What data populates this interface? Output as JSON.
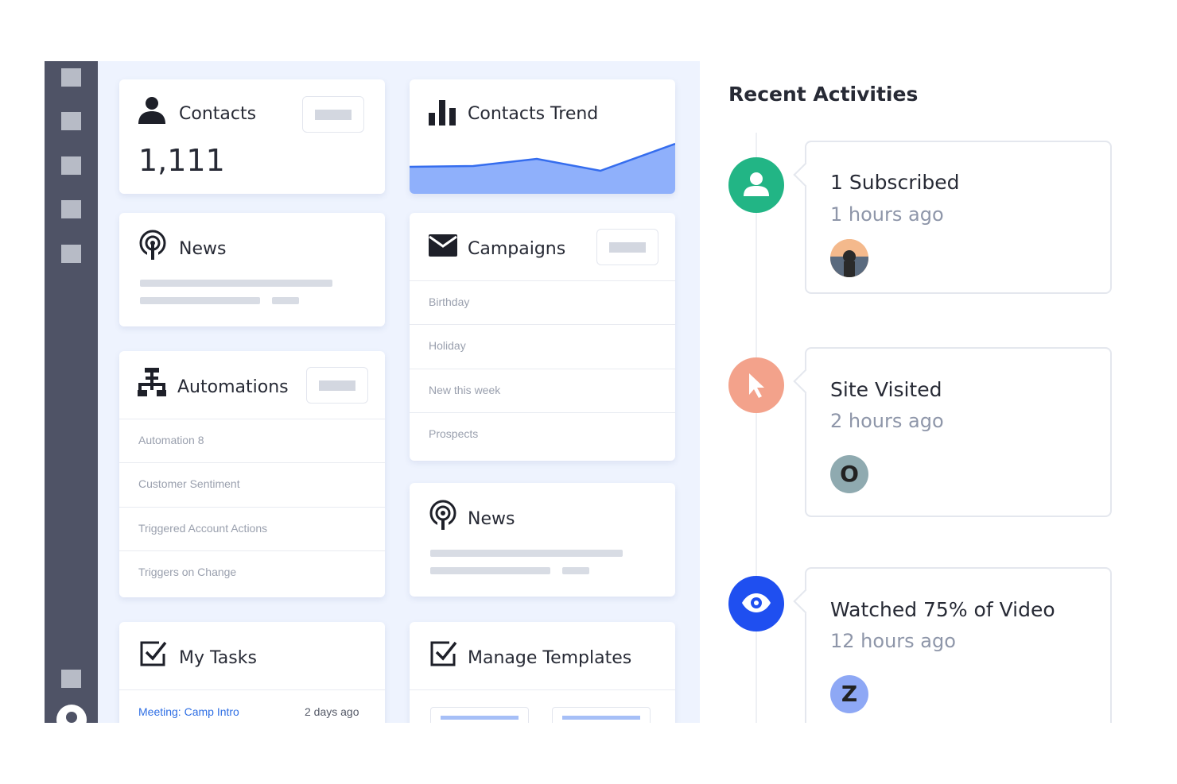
{
  "dashboard": {
    "contacts": {
      "title": "Contacts",
      "count": "1,111"
    },
    "contacts_trend": {
      "title": "Contacts Trend"
    },
    "news_1": {
      "title": "News"
    },
    "campaigns": {
      "title": "Campaigns",
      "items": [
        "Birthday",
        "Holiday",
        "New this week",
        "Prospects"
      ]
    },
    "automations": {
      "title": "Automations",
      "items": [
        "Automation 8",
        "Customer Sentiment",
        "Triggered Account Actions",
        "Triggers on Change"
      ]
    },
    "news_2": {
      "title": "News"
    },
    "my_tasks": {
      "title": "My Tasks",
      "task_label": "Meeting: Camp Intro",
      "task_time": "2 days ago"
    },
    "manage_templates": {
      "title": "Manage Templates"
    }
  },
  "activities": {
    "title": "Recent Activities",
    "items": [
      {
        "event": "1 Subscribed",
        "time": "1 hours ago",
        "avatar": "",
        "icon": "person-icon",
        "color": "#22b585"
      },
      {
        "event": "Site Visited",
        "time": "2 hours ago",
        "avatar": "O",
        "icon": "cursor-icon",
        "color": "#f3a28b"
      },
      {
        "event": "Watched 75% of Video",
        "time": "12 hours ago",
        "avatar": "Z",
        "icon": "eye-icon",
        "color": "#1f4ff0"
      }
    ]
  },
  "colors": {
    "sidebar": "#4f5366",
    "dashboard_bg": "#eef3fe",
    "trend_fill": "#8fb0fb",
    "trend_line": "#356dee",
    "link": "#2f6fe4"
  }
}
